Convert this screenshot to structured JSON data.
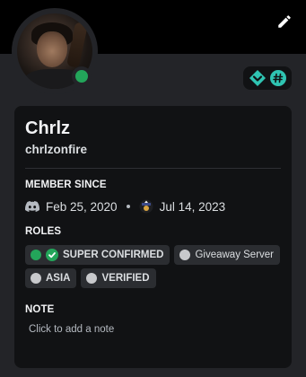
{
  "profile": {
    "display_name": "Chrlz",
    "username": "chrlzonfire",
    "status_color": "#23a55a"
  },
  "member_since": {
    "title": "MEMBER SINCE",
    "discord_date": "Feb 25, 2020",
    "server_date": "Jul 14, 2023",
    "discord_icon": "discord-logo-icon",
    "server_icon": "server-icon"
  },
  "roles": {
    "title": "ROLES",
    "items": [
      {
        "label": "SUPER CONFIRMED",
        "color": "#23a55a",
        "icon": "check-circle-icon"
      },
      {
        "label": "Giveaway Server",
        "color": "#c8c9cc"
      },
      {
        "label": "ASIA",
        "color": "#c8c9cc"
      },
      {
        "label": "VERIFIED",
        "color": "#c8c9cc"
      }
    ]
  },
  "note": {
    "title": "NOTE",
    "placeholder": "Click to add a note"
  },
  "badges": [
    "hypesquad-balance-icon",
    "hashtag-icon"
  ],
  "colors": {
    "accent_green": "#23a55a",
    "badge_teal": "#2fc4b2",
    "card_bg": "#111214",
    "panel_bg": "#232428"
  }
}
